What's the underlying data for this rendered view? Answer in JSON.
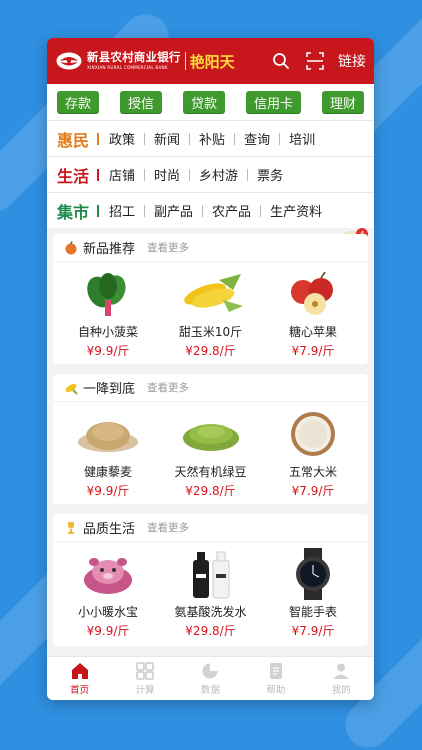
{
  "colors": {
    "brand_red": "#c8161d",
    "green": "#3f9a2d",
    "price_red": "#d4141c"
  },
  "header": {
    "bank_name_cn": "新县农村商业银行",
    "bank_name_en": "XINXIAN RURAL COMMERCIAL BANK",
    "brand": "艳阳天",
    "link_label": "链接",
    "icons": [
      "search-icon",
      "scan-icon"
    ]
  },
  "finance_buttons": [
    "存款",
    "授信",
    "贷款",
    "信用卡",
    "理财"
  ],
  "categories": [
    {
      "head": "惠民",
      "color": "#e47c1c",
      "items": [
        "政策",
        "新闻",
        "补贴",
        "查询",
        "培训"
      ]
    },
    {
      "head": "生活",
      "color": "#c8161d",
      "items": [
        "店铺",
        "时尚",
        "乡村游",
        "票务"
      ]
    },
    {
      "head": "集市",
      "color": "#1f8a4c",
      "items": [
        "招工",
        "副产品",
        "农产品",
        "生产资料"
      ]
    }
  ],
  "cart_badge": "4",
  "sections": [
    {
      "title": "新品推荐",
      "more": "查看更多",
      "icon": "fruit-icon",
      "items": [
        {
          "name": "自种小菠菜",
          "price": "¥9.9/斤",
          "icon": "spinach-icon"
        },
        {
          "name": "甜玉米10斤",
          "price": "¥29.8/斤",
          "icon": "corn-icon"
        },
        {
          "name": "糖心苹果",
          "price": "¥7.9/斤",
          "icon": "apple-icon"
        }
      ]
    },
    {
      "title": "一降到底",
      "more": "查看更多",
      "icon": "corn-small-icon",
      "items": [
        {
          "name": "健康藜麦",
          "price": "¥9.9/斤",
          "icon": "quinoa-icon"
        },
        {
          "name": "天然有机绿豆",
          "price": "¥29.8/斤",
          "icon": "mung-bean-icon"
        },
        {
          "name": "五常大米",
          "price": "¥7.9/斤",
          "icon": "rice-icon"
        }
      ]
    },
    {
      "title": "品质生活",
      "more": "查看更多",
      "icon": "trophy-icon",
      "items": [
        {
          "name": "小小暖水宝",
          "price": "¥9.9/斤",
          "icon": "hot-water-bag-icon"
        },
        {
          "name": "氨基酸洗发水",
          "price": "¥29.8/斤",
          "icon": "shampoo-icon"
        },
        {
          "name": "智能手表",
          "price": "¥7.9/斤",
          "icon": "smartwatch-icon"
        }
      ]
    }
  ],
  "tabs": [
    {
      "label": "首页",
      "icon": "home-icon",
      "active": true
    },
    {
      "label": "计算",
      "icon": "calculator-icon",
      "active": false
    },
    {
      "label": "数据",
      "icon": "pie-chart-icon",
      "active": false
    },
    {
      "label": "帮助",
      "icon": "help-document-icon",
      "active": false
    },
    {
      "label": "我的",
      "icon": "user-icon",
      "active": false
    }
  ]
}
